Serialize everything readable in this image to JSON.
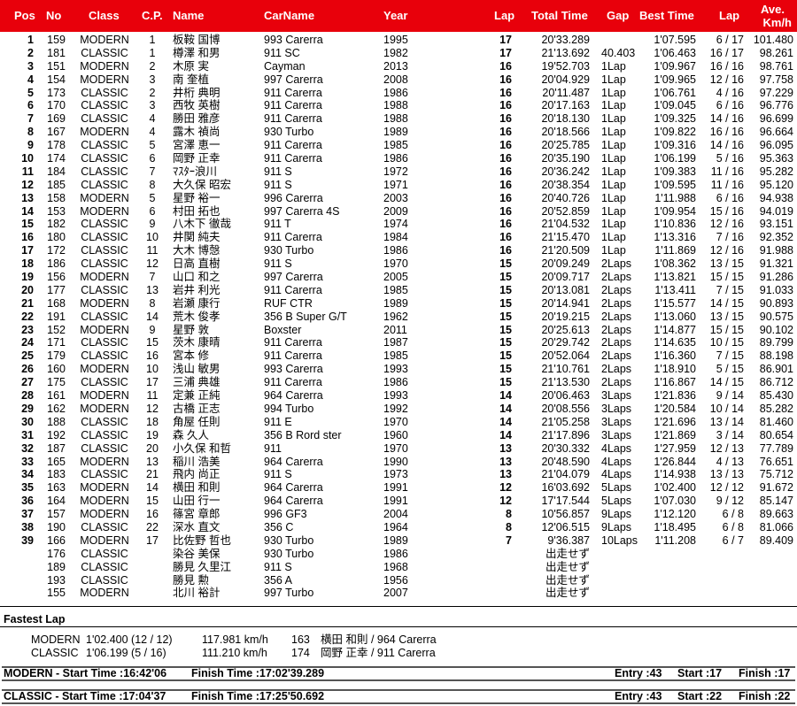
{
  "header": {
    "pos": "Pos",
    "no": "No",
    "class": "Class",
    "cp": "C.P.",
    "name": "Name",
    "carname": "CarName",
    "year": "Year",
    "lap": "Lap",
    "total": "Total Time",
    "gap": "Gap",
    "best": "Best Time",
    "bestlap": "Lap",
    "ave1": "Ave.",
    "ave2": "Km/h"
  },
  "results": [
    [
      "1",
      "159",
      "MODERN",
      "1",
      "板鞍 国博",
      "993 Carerra",
      "1995",
      "17",
      "20'33.289",
      "",
      "1'07.595",
      "6 / 17",
      "101.480"
    ],
    [
      "2",
      "181",
      "CLASSIC",
      "1",
      "樽澤 和男",
      "911 SC",
      "1982",
      "17",
      "21'13.692",
      "40.403",
      "1'06.463",
      "16 / 17",
      "98.261"
    ],
    [
      "3",
      "151",
      "MODERN",
      "2",
      "木原 実",
      "Cayman",
      "2013",
      "16",
      "19'52.703",
      "1Lap",
      "1'09.967",
      "16 / 16",
      "98.761"
    ],
    [
      "4",
      "154",
      "MODERN",
      "3",
      "南 奎植",
      "997 Carerra",
      "2008",
      "16",
      "20'04.929",
      "1Lap",
      "1'09.965",
      "12 / 16",
      "97.758"
    ],
    [
      "5",
      "173",
      "CLASSIC",
      "2",
      "井桁 典明",
      "911 Carerra",
      "1986",
      "16",
      "20'11.487",
      "1Lap",
      "1'06.761",
      "4 / 16",
      "97.229"
    ],
    [
      "6",
      "170",
      "CLASSIC",
      "3",
      "西牧 英樹",
      "911 Carerra",
      "1988",
      "16",
      "20'17.163",
      "1Lap",
      "1'09.045",
      "6 / 16",
      "96.776"
    ],
    [
      "7",
      "169",
      "CLASSIC",
      "4",
      "勝田 雅彦",
      "911 Carerra",
      "1988",
      "16",
      "20'18.130",
      "1Lap",
      "1'09.325",
      "14 / 16",
      "96.699"
    ],
    [
      "8",
      "167",
      "MODERN",
      "4",
      "露木 禎尚",
      "930 Turbo",
      "1989",
      "16",
      "20'18.566",
      "1Lap",
      "1'09.822",
      "16 / 16",
      "96.664"
    ],
    [
      "9",
      "178",
      "CLASSIC",
      "5",
      "宮澤 恵一",
      "911 Carerra",
      "1985",
      "16",
      "20'25.785",
      "1Lap",
      "1'09.316",
      "14 / 16",
      "96.095"
    ],
    [
      "10",
      "174",
      "CLASSIC",
      "6",
      "岡野 正幸",
      "911 Carerra",
      "1986",
      "16",
      "20'35.190",
      "1Lap",
      "1'06.199",
      "5 / 16",
      "95.363"
    ],
    [
      "11",
      "184",
      "CLASSIC",
      "7",
      "ﾏｽﾀｰ浪川",
      "911 S",
      "1972",
      "16",
      "20'36.242",
      "1Lap",
      "1'09.383",
      "11 / 16",
      "95.282"
    ],
    [
      "12",
      "185",
      "CLASSIC",
      "8",
      "大久保 昭宏",
      "911 S",
      "1971",
      "16",
      "20'38.354",
      "1Lap",
      "1'09.595",
      "11 / 16",
      "95.120"
    ],
    [
      "13",
      "158",
      "MODERN",
      "5",
      "星野 裕一",
      "996 Carerra",
      "2003",
      "16",
      "20'40.726",
      "1Lap",
      "1'11.988",
      "6 / 16",
      "94.938"
    ],
    [
      "14",
      "153",
      "MODERN",
      "6",
      "村田 拓也",
      "997 Carerra 4S",
      "2009",
      "16",
      "20'52.859",
      "1Lap",
      "1'09.954",
      "15 / 16",
      "94.019"
    ],
    [
      "15",
      "182",
      "CLASSIC",
      "9",
      "八木下 徹哉",
      "911 T",
      "1974",
      "16",
      "21'04.532",
      "1Lap",
      "1'10.836",
      "12 / 16",
      "93.151"
    ],
    [
      "16",
      "180",
      "CLASSIC",
      "10",
      "井関 純夫",
      "911 Carerra",
      "1984",
      "16",
      "21'15.470",
      "1Lap",
      "1'13.316",
      "7 / 16",
      "92.352"
    ],
    [
      "17",
      "172",
      "CLASSIC",
      "11",
      "大木 博愨",
      "930 Turbo",
      "1986",
      "16",
      "21'20.509",
      "1Lap",
      "1'11.869",
      "12 / 16",
      "91.988"
    ],
    [
      "18",
      "186",
      "CLASSIC",
      "12",
      "日高 直樹",
      "911 S",
      "1970",
      "15",
      "20'09.249",
      "2Laps",
      "1'08.362",
      "13 / 15",
      "91.321"
    ],
    [
      "19",
      "156",
      "MODERN",
      "7",
      "山口 和之",
      "997 Carerra",
      "2005",
      "15",
      "20'09.717",
      "2Laps",
      "1'13.821",
      "15 / 15",
      "91.286"
    ],
    [
      "20",
      "177",
      "CLASSIC",
      "13",
      "岩井 利光",
      "911 Carerra",
      "1985",
      "15",
      "20'13.081",
      "2Laps",
      "1'13.411",
      "7 / 15",
      "91.033"
    ],
    [
      "21",
      "168",
      "MODERN",
      "8",
      "岩瀬 康行",
      "RUF CTR",
      "1989",
      "15",
      "20'14.941",
      "2Laps",
      "1'15.577",
      "14 / 15",
      "90.893"
    ],
    [
      "22",
      "191",
      "CLASSIC",
      "14",
      "荒木 俊孝",
      "356 B Super G/T",
      "1962",
      "15",
      "20'19.215",
      "2Laps",
      "1'13.060",
      "13 / 15",
      "90.575"
    ],
    [
      "23",
      "152",
      "MODERN",
      "9",
      "星野 敦",
      "Boxster",
      "2011",
      "15",
      "20'25.613",
      "2Laps",
      "1'14.877",
      "15 / 15",
      "90.102"
    ],
    [
      "24",
      "171",
      "CLASSIC",
      "15",
      "茨木 康晴",
      "911 Carerra",
      "1987",
      "15",
      "20'29.742",
      "2Laps",
      "1'14.635",
      "10 / 15",
      "89.799"
    ],
    [
      "25",
      "179",
      "CLASSIC",
      "16",
      "宮本 修",
      "911 Carerra",
      "1985",
      "15",
      "20'52.064",
      "2Laps",
      "1'16.360",
      "7 / 15",
      "88.198"
    ],
    [
      "26",
      "160",
      "MODERN",
      "10",
      "浅山 敏男",
      "993 Carerra",
      "1993",
      "15",
      "21'10.761",
      "2Laps",
      "1'18.910",
      "5 / 15",
      "86.901"
    ],
    [
      "27",
      "175",
      "CLASSIC",
      "17",
      "三浦 典雄",
      "911 Carerra",
      "1986",
      "15",
      "21'13.530",
      "2Laps",
      "1'16.867",
      "14 / 15",
      "86.712"
    ],
    [
      "28",
      "161",
      "MODERN",
      "11",
      "定兼 正純",
      "964 Carerra",
      "1993",
      "14",
      "20'06.463",
      "3Laps",
      "1'21.836",
      "9 / 14",
      "85.430"
    ],
    [
      "29",
      "162",
      "MODERN",
      "12",
      "古橋 正志",
      "994 Turbo",
      "1992",
      "14",
      "20'08.556",
      "3Laps",
      "1'20.584",
      "10 / 14",
      "85.282"
    ],
    [
      "30",
      "188",
      "CLASSIC",
      "18",
      "角屋 任則",
      "911 E",
      "1970",
      "14",
      "21'05.258",
      "3Laps",
      "1'21.696",
      "13 / 14",
      "81.460"
    ],
    [
      "31",
      "192",
      "CLASSIC",
      "19",
      "森 久人",
      "356 B Rord ster",
      "1960",
      "14",
      "21'17.896",
      "3Laps",
      "1'21.869",
      "3 / 14",
      "80.654"
    ],
    [
      "32",
      "187",
      "CLASSIC",
      "20",
      "小久保 和哲",
      "911",
      "1970",
      "13",
      "20'30.332",
      "4Laps",
      "1'27.959",
      "12 / 13",
      "77.789"
    ],
    [
      "33",
      "165",
      "MODERN",
      "13",
      "稲川 浩美",
      "964 Carerra",
      "1990",
      "13",
      "20'48.590",
      "4Laps",
      "1'26.844",
      "4 / 13",
      "76.651"
    ],
    [
      "34",
      "183",
      "CLASSIC",
      "21",
      "飛内 尚正",
      "911 S",
      "1973",
      "13",
      "21'04.079",
      "4Laps",
      "1'14.938",
      "13 / 13",
      "75.712"
    ],
    [
      "35",
      "163",
      "MODERN",
      "14",
      "横田 和則",
      "964 Carerra",
      "1991",
      "12",
      "16'03.692",
      "5Laps",
      "1'02.400",
      "12 / 12",
      "91.672"
    ],
    [
      "36",
      "164",
      "MODERN",
      "15",
      "山田 行一",
      "964 Carerra",
      "1991",
      "12",
      "17'17.544",
      "5Laps",
      "1'07.030",
      "9 / 12",
      "85.147"
    ],
    [
      "37",
      "157",
      "MODERN",
      "16",
      "篠宮 章郎",
      "996 GF3",
      "2004",
      "8",
      "10'56.857",
      "9Laps",
      "1'12.120",
      "6 / 8",
      "89.663"
    ],
    [
      "38",
      "190",
      "CLASSIC",
      "22",
      "深水 直文",
      "356 C",
      "1964",
      "8",
      "12'06.515",
      "9Laps",
      "1'18.495",
      "6 / 8",
      "81.066"
    ],
    [
      "39",
      "166",
      "MODERN",
      "17",
      "比佐野 哲也",
      "930 Turbo",
      "1989",
      "7",
      "9'36.387",
      "10Laps",
      "1'11.208",
      "6 / 7",
      "89.409"
    ],
    [
      "",
      "176",
      "CLASSIC",
      "",
      "染谷 美保",
      "930 Turbo",
      "1986",
      "",
      "出走せず",
      "",
      "",
      "",
      ""
    ],
    [
      "",
      "189",
      "CLASSIC",
      "",
      "勝見 久里江",
      "911 S",
      "1968",
      "",
      "出走せず",
      "",
      "",
      "",
      ""
    ],
    [
      "",
      "193",
      "CLASSIC",
      "",
      "勝見 勲",
      "356 A",
      "1956",
      "",
      "出走せず",
      "",
      "",
      "",
      ""
    ],
    [
      "",
      "155",
      "MODERN",
      "",
      "北川 裕計",
      "997 Turbo",
      "2007",
      "",
      "出走せず",
      "",
      "",
      "",
      ""
    ]
  ],
  "fastest": {
    "title": "Fastest Lap",
    "rows": [
      {
        "cls": "MODERN",
        "time": "1'02.400 (12 / 12)",
        "speed": "117.981 km/h",
        "no": "163",
        "who": "横田 和則 / 964 Carerra"
      },
      {
        "cls": "CLASSIC",
        "time": "1'06.199 (5 / 16)",
        "speed": "111.210 km/h",
        "no": "174",
        "who": "岡野 正幸 / 911 Carerra"
      }
    ]
  },
  "summary": [
    {
      "start": "MODERN - Start Time :16:42'06",
      "finish": "Finish Time :17:02'39.289",
      "entry": "Entry :43",
      "started": "Start :17",
      "finished": "Finish :17"
    },
    {
      "start": "CLASSIC - Start Time :17:04'37",
      "finish": "Finish Time :17:25'50.692",
      "entry": "Entry :43",
      "started": "Start :22",
      "finished": "Finish :22"
    }
  ]
}
